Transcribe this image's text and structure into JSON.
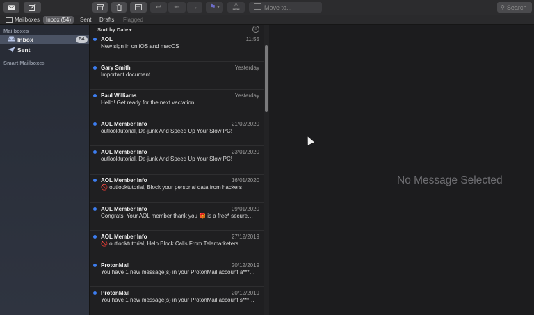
{
  "toolbar": {
    "get_mail_icon": "envelope-icon",
    "compose_icon": "compose-icon",
    "archive_icon": "archive-icon",
    "trash_icon": "trash-icon",
    "junk_icon": "junk-icon",
    "reply_icon": "reply-arrow-icon",
    "reply_all_icon": "reply-all-icon",
    "forward_icon": "forward-arrow-icon",
    "flag_icon": "flag-icon",
    "mute_icon": "bell-icon",
    "move_to_label": "Move to...",
    "search_placeholder": "Search"
  },
  "favorites": {
    "mailboxes": "Mailboxes",
    "inbox": "Inbox (54)",
    "sent": "Sent",
    "drafts": "Drafts",
    "flagged": "Flagged"
  },
  "sidebar": {
    "section_mailboxes": "Mailboxes",
    "inbox_label": "Inbox",
    "inbox_count": "54",
    "sent_label": "Sent",
    "section_smart": "Smart Mailboxes"
  },
  "list": {
    "sort_label": "Sort by Date",
    "messages": [
      {
        "sender": "AOL",
        "date": "11:55",
        "subject": "New sign in on iOS and macOS",
        "unread": true
      },
      {
        "sender": "Gary Smith",
        "date": "Yesterday",
        "subject": "Important document",
        "unread": true
      },
      {
        "sender": "Paul Williams",
        "date": "Yesterday",
        "subject": "Hello! Get ready for the next vactation!",
        "unread": true
      },
      {
        "sender": "AOL Member Info",
        "date": "21/02/2020",
        "subject": "outlooktutorial, De-junk And Speed Up Your Slow PC!",
        "unread": true
      },
      {
        "sender": "AOL Member Info",
        "date": "23/01/2020",
        "subject": "outlooktutorial, De-junk And Speed Up Your Slow PC!",
        "unread": true
      },
      {
        "sender": "AOL Member Info",
        "date": "16/01/2020",
        "subject": "🚫 outlooktutorial, Block your personal data from hackers",
        "unread": true
      },
      {
        "sender": "AOL Member Info",
        "date": "09/01/2020",
        "subject": "Congrats! Your AOL member thank you 🎁 is a free* secure…",
        "unread": true
      },
      {
        "sender": "AOL Member Info",
        "date": "27/12/2019",
        "subject": "🚫 outlooktutorial, Help Block Calls From Telemarketers",
        "unread": true
      },
      {
        "sender": "ProtonMail",
        "date": "20/12/2019",
        "subject": "You have 1 new message(s) in your ProtonMail account a***…",
        "unread": true
      },
      {
        "sender": "ProtonMail",
        "date": "20/12/2019",
        "subject": "You have 1 new message(s) in your ProtonMail account s***…",
        "unread": true
      }
    ]
  },
  "reader": {
    "empty_text": "No Message Selected"
  }
}
